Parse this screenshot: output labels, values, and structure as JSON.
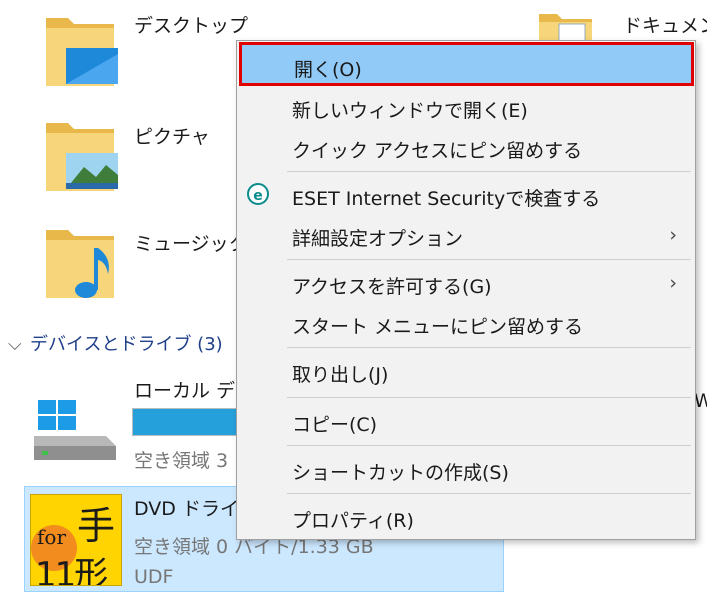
{
  "folders": {
    "desktop": "デスクトップ",
    "documents": "ドキュメン",
    "pictures": "ピクチャ",
    "music": "ミュージック"
  },
  "devices_section": {
    "label": "デバイスとドライブ (3)"
  },
  "drives": {
    "local": {
      "name": "ローカル ディ",
      "free": "空き領域 3",
      "usage_fraction": 0.85
    },
    "dvd": {
      "name": "DVD ドライ",
      "free": "空き領域 0 バイト/1.33 GB",
      "fs": "UDF",
      "icon_text_top": "for",
      "icon_text_hand": "手",
      "icon_text_bottom": "11形"
    }
  },
  "right_edge_fragment": "W",
  "context_menu": {
    "items": [
      {
        "label": "開く(O)"
      },
      {
        "label": "新しいウィンドウで開く(E)"
      },
      {
        "label": "クイック アクセスにピン留めする"
      },
      {
        "label": "ESET Internet Securityで検査する",
        "icon": "eset-icon"
      },
      {
        "label": "詳細設定オプション",
        "submenu": true
      },
      {
        "label": "アクセスを許可する(G)",
        "submenu": true
      },
      {
        "label": "スタート メニューにピン留めする"
      },
      {
        "label": "取り出し(J)"
      },
      {
        "label": "コピー(C)"
      },
      {
        "label": "ショートカットの作成(S)"
      },
      {
        "label": "プロパティ(R)"
      }
    ],
    "submenu_arrow": "›",
    "eset_glyph": "e"
  },
  "colors": {
    "highlight_bg": "#91c9f7",
    "highlight_border": "#e00000",
    "selection_bg": "#cce8ff",
    "drive_bar": "#26a0da"
  }
}
